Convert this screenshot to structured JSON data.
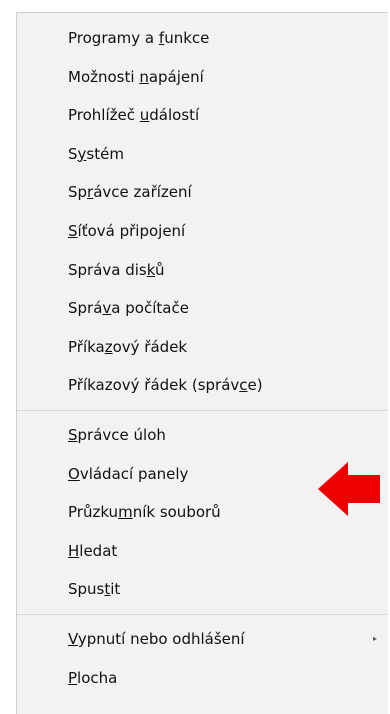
{
  "menu": {
    "groups": [
      {
        "items": [
          {
            "pre": "Programy a ",
            "acc": "f",
            "post": "unkce"
          },
          {
            "pre": "Možnosti ",
            "acc": "n",
            "post": "apájení"
          },
          {
            "pre": "Prohlížeč ",
            "acc": "u",
            "post": "dálostí"
          },
          {
            "pre": "S",
            "acc": "y",
            "post": "stém"
          },
          {
            "pre": "Sp",
            "acc": "r",
            "post": "ávce zařízení"
          },
          {
            "pre": "",
            "acc": "S",
            "post": "íťová připojení"
          },
          {
            "pre": "Správa dis",
            "acc": "k",
            "post": "ů"
          },
          {
            "pre": "Sprá",
            "acc": "v",
            "post": "a počítače"
          },
          {
            "pre": "Příka",
            "acc": "z",
            "post": "ový řádek"
          },
          {
            "pre": "Příkazový řádek (správ",
            "acc": "c",
            "post": "e)"
          }
        ]
      },
      {
        "items": [
          {
            "pre": "",
            "acc": "S",
            "post": "právce úloh"
          },
          {
            "pre": "",
            "acc": "O",
            "post": "vládací panely"
          },
          {
            "pre": "Průzku",
            "acc": "m",
            "post": "ník souborů"
          },
          {
            "pre": "",
            "acc": "H",
            "post": "ledat"
          },
          {
            "pre": "Spus",
            "acc": "t",
            "post": "it"
          }
        ]
      },
      {
        "items": [
          {
            "pre": "",
            "acc": "V",
            "post": "ypnutí nebo odhlášení",
            "submenu_indicator": "▸"
          },
          {
            "pre": "",
            "acc": "P",
            "post": "locha"
          }
        ]
      }
    ]
  },
  "annotation": {
    "arrow_color": "#ee0000",
    "arrow_direction": "left"
  }
}
